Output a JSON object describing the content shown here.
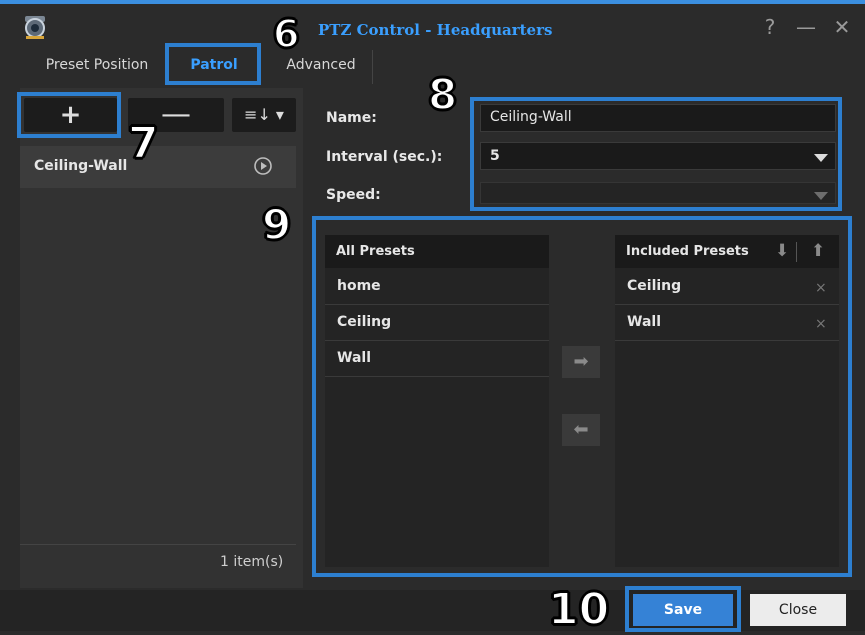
{
  "window": {
    "title": "PTZ Control - Headquarters",
    "help_glyph": "?",
    "minimize_glyph": "—",
    "close_glyph": "✕"
  },
  "tabs": [
    {
      "label": "Preset Position"
    },
    {
      "label": "Patrol",
      "active": true
    },
    {
      "label": "Advanced"
    }
  ],
  "toolbar": {
    "add_glyph": "+",
    "remove_glyph": "—",
    "sort_glyph": "≡↓ ▾"
  },
  "patrol_list": {
    "items": [
      {
        "label": "Ceiling-Wall"
      }
    ],
    "count": "1 item(s)"
  },
  "form": {
    "name_label": "Name:",
    "name_value": "Ceiling-Wall",
    "interval_label": "Interval (sec.):",
    "interval_value": "5",
    "speed_label": "Speed:"
  },
  "presets": {
    "all_header": "All Presets",
    "all_items": [
      {
        "label": "home"
      },
      {
        "label": "Ceiling"
      },
      {
        "label": "Wall"
      }
    ],
    "included_header": "Included Presets",
    "included_items": [
      {
        "label": "Ceiling"
      },
      {
        "label": "Wall"
      }
    ],
    "remove_glyph": "×",
    "move_right_glyph": "➡",
    "move_left_glyph": "⬅",
    "move_down_glyph": "⬇",
    "move_up_glyph": "⬆"
  },
  "footer": {
    "save_label": "Save",
    "close_label": "Close"
  },
  "callouts": {
    "c6": "6",
    "c7": "7",
    "c8": "8",
    "c9": "9",
    "c10": "10"
  },
  "colors": {
    "accent": "#3a9fff",
    "highlight_border": "#2d7fd0",
    "save_button": "#3582d6"
  }
}
